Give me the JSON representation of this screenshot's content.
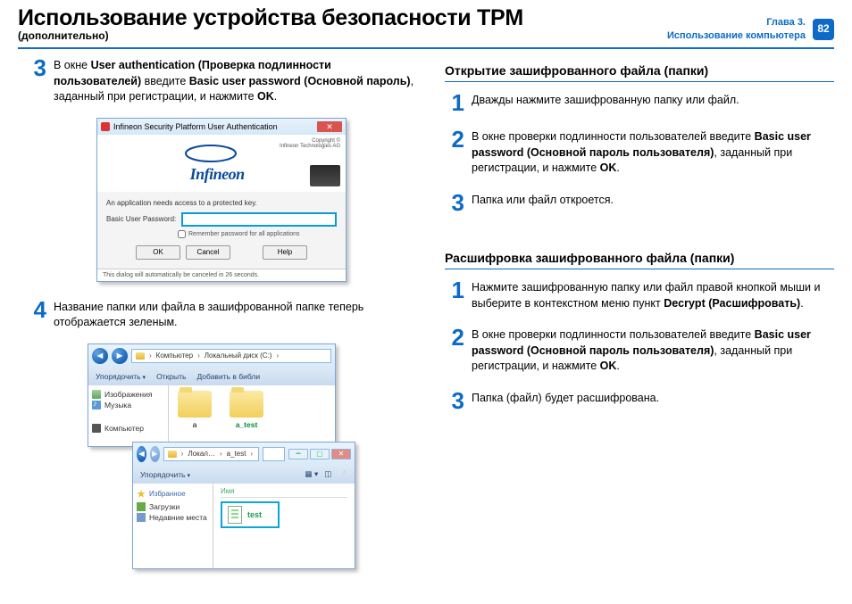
{
  "header": {
    "title": "Использование устройства безопасности TPM",
    "subtitle": "(дополнительно)",
    "chapter_line1": "Глава 3.",
    "chapter_line2": "Использование компьютера",
    "page_number": "82"
  },
  "left": {
    "step3": {
      "num": "3",
      "t1": "В окне ",
      "b1": "User authentication (Проверка подлинности пользователей)",
      "t2": " введите ",
      "b2": "Basic user password (Основной пароль)",
      "t3": ", заданный при регистрации, и нажмите ",
      "b3": "OK",
      "t4": "."
    },
    "dialog": {
      "title": "Infineon Security Platform User Authentication",
      "brand": "Infineon",
      "copyright1": "Copyright ©",
      "copyright2": "Infineon Technologies AG",
      "body_line": "An application needs access to a protected key.",
      "pwd_label": "Basic User Password:",
      "remember": "Remember password for all applications",
      "btn_ok": "OK",
      "btn_cancel": "Cancel",
      "btn_help": "Help",
      "footer": "This dialog will automatically be canceled in 26 seconds."
    },
    "step4": {
      "num": "4",
      "text": "Название папки или файла в зашифрованной папке теперь отображается зеленым."
    },
    "explorer_back": {
      "bc_computer": "Компьютер",
      "bc_disk": "Локальный диск (C:)",
      "tb_org": "Упорядочить",
      "tb_open": "Открыть",
      "tb_lib": "Добавить в библи",
      "side_pic": "Изображения",
      "side_mus": "Музыка",
      "side_pc": "Компьютер",
      "folder_a": "a",
      "folder_b": "a_test"
    },
    "explorer_front": {
      "bc_local": "Локал…",
      "bc_folder": "a_test",
      "tb_org": "Упорядочить",
      "side_fav": "Избранное",
      "side_dl": "Загрузки",
      "side_rc": "Недавние места",
      "col_name": "Имя",
      "file": "test"
    }
  },
  "right": {
    "sec1_title": "Открытие зашифрованного файла (папки)",
    "s1_1": {
      "num": "1",
      "text": "Дважды нажмите зашифрованную папку или файл."
    },
    "s1_2": {
      "num": "2",
      "t1": "В окне проверки подлинности пользователей введите ",
      "b1": "Basic user password (Основной пароль пользователя)",
      "t2": ", заданный при регистрации, и нажмите ",
      "b2": "OK",
      "t3": "."
    },
    "s1_3": {
      "num": "3",
      "text": "Папка или файл откроется."
    },
    "sec2_title": "Расшифровка зашифрованного файла (папки)",
    "s2_1": {
      "num": "1",
      "t1": "Нажмите зашифрованную папку или файл правой кнопкой мыши и выберите в контекстном меню пункт ",
      "b1": "Decrypt (Расшифровать)",
      "t2": "."
    },
    "s2_2": {
      "num": "2",
      "t1": "В окне проверки подлинности пользователей введите ",
      "b1": "Basic user password (Основной пароль пользователя)",
      "t2": ", заданный при регистрации, и нажмите ",
      "b2": "OK",
      "t3": "."
    },
    "s2_3": {
      "num": "3",
      "text": "Папка (файл) будет расшифрована."
    }
  }
}
